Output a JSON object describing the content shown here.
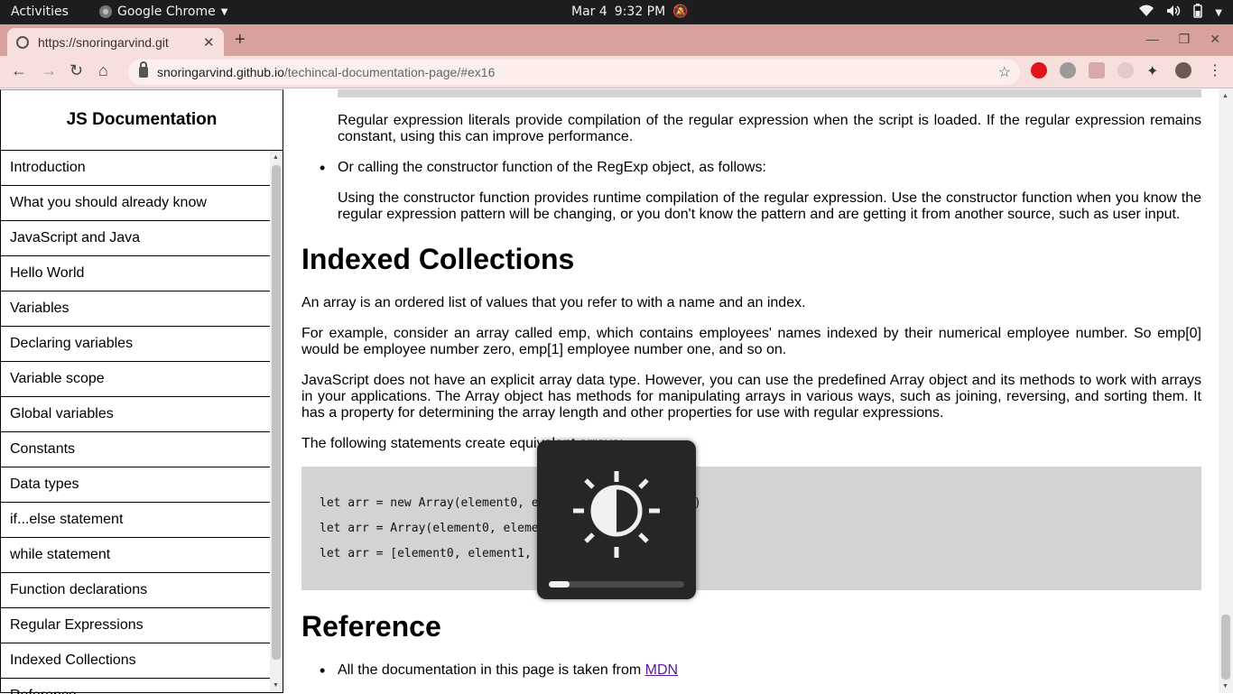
{
  "system_bar": {
    "activities": "Activities",
    "app_name": "Google Chrome",
    "date": "Mar 4",
    "time": "9:32 PM"
  },
  "browser": {
    "tab_title": "https://snoringarvind.git",
    "url_host": "snoringarvind.github.io",
    "url_path": "/techincal-documentation-page/#ex16"
  },
  "sidebar": {
    "title": "JS Documentation",
    "items": [
      "Introduction",
      "What you should already know",
      "JavaScript and Java",
      "Hello World",
      "Variables",
      "Declaring variables",
      "Variable scope",
      "Global variables",
      "Constants",
      "Data types",
      "if...else statement",
      "while statement",
      "Function declarations",
      "Regular Expressions",
      "Indexed Collections",
      "Reference"
    ]
  },
  "main": {
    "regex_literal_para": "Regular expression literals provide compilation of the regular expression when the script is loaded. If the regular expression remains constant, using this can improve performance.",
    "regex_ctor_bullet": "Or calling the constructor function of the RegExp object, as follows:",
    "regex_ctor_para": "Using the constructor function provides runtime compilation of the regular expression. Use the constructor function when you know the regular expression pattern will be changing, or you don't know the pattern and are getting it from another source, such as user input.",
    "indexed_heading": "Indexed Collections",
    "indexed_p1": "An array is an ordered list of values that you refer to with a name and an index.",
    "indexed_p2": "For example, consider an array called emp, which contains employees' names indexed by their numerical employee number. So emp[0] would be employee number zero, emp[1] employee number one, and so on.",
    "indexed_p3": "JavaScript does not have an explicit array data type. However, you can use the predefined Array object and its methods to work with arrays in your applications. The Array object has methods for manipulating arrays in various ways, such as joining, reversing, and sorting them. It has a property for determining the array length and other properties for use with regular expressions.",
    "indexed_p4": "The following statements create equivalent arrays:",
    "code_lines": [
      "let arr = new Array(element0, element1, ..., elementN)",
      "let arr = Array(element0, element1, ..., elementN)",
      "let arr = [element0, element1, ..., elementN]"
    ],
    "reference_heading": "Reference",
    "reference_text": "All the documentation in this page is taken from ",
    "reference_link": "MDN"
  },
  "brightness_osd": {
    "level_fraction": 0.15
  }
}
